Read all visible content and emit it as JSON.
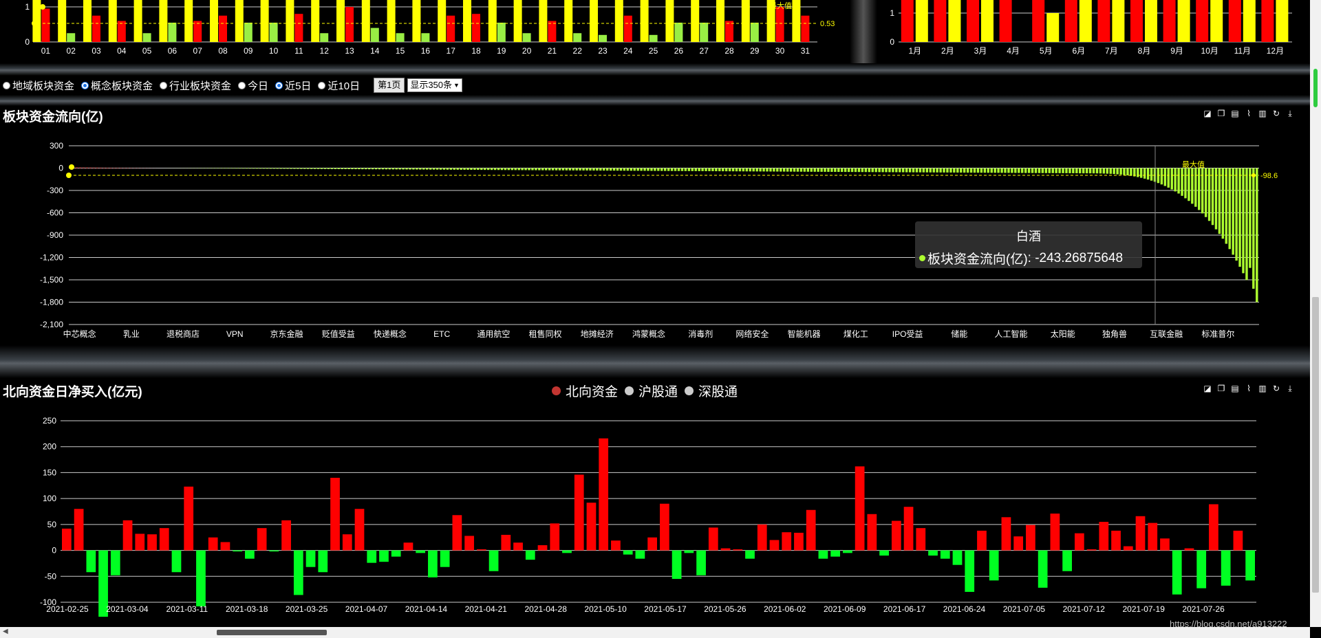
{
  "top_left_chart": {
    "categories": [
      "01",
      "02",
      "03",
      "04",
      "05",
      "06",
      "07",
      "08",
      "09",
      "10",
      "11",
      "12",
      "13",
      "14",
      "15",
      "16",
      "17",
      "18",
      "19",
      "20",
      "21",
      "22",
      "23",
      "24",
      "25",
      "26",
      "27",
      "28",
      "29",
      "30",
      "31"
    ],
    "values": [
      0.95,
      0.25,
      0.75,
      0.6,
      0.25,
      0.55,
      0.6,
      0.75,
      0.55,
      0.55,
      0.8,
      0.25,
      1.0,
      0.4,
      0.25,
      0.25,
      0.75,
      0.8,
      0.55,
      0.25,
      0.6,
      0.25,
      0.2,
      0.75,
      0.2,
      0.55,
      0.55,
      0.6,
      0.55,
      1.0,
      0.75
    ],
    "colors": [
      "#ff0000",
      "#99ee44",
      "#ff0000",
      "#ff0000",
      "#99ee44",
      "#99ee44",
      "#ff0000",
      "#ff0000",
      "#99ee44",
      "#99ee44",
      "#ff0000",
      "#99ee44",
      "#ff0000",
      "#99ee44",
      "#99ee44",
      "#99ee44",
      "#ff0000",
      "#ff0000",
      "#99ee44",
      "#99ee44",
      "#ff0000",
      "#99ee44",
      "#99ee44",
      "#ff0000",
      "#99ee44",
      "#99ee44",
      "#99ee44",
      "#ff0000",
      "#99ee44",
      "#ff0000",
      "#ff0000"
    ],
    "y_ticks": [
      "0",
      "1"
    ],
    "avg_label": "0.53",
    "max_label": "最大值"
  },
  "top_right_chart": {
    "categories": [
      "1月",
      "2月",
      "3月",
      "4月",
      "5月",
      "6月",
      "7月",
      "8月",
      "9月",
      "10月",
      "11月",
      "12月"
    ],
    "y_ticks": [
      "0",
      "1"
    ]
  },
  "controls": {
    "options": [
      {
        "label": "地域板块资金",
        "checked": false
      },
      {
        "label": "概念板块资金",
        "checked": true
      },
      {
        "label": "行业板块资金",
        "checked": false
      },
      {
        "label": "今日",
        "checked": false
      },
      {
        "label": "近5日",
        "checked": true
      },
      {
        "label": "近10日",
        "checked": false
      }
    ],
    "page_button": "第1页",
    "display_select": "显示350条"
  },
  "chart_data": [
    {
      "type": "bar",
      "title": "板块资金流向(亿)",
      "ylim": [
        -2100,
        300
      ],
      "y_ticks": [
        "300",
        "0",
        "-300",
        "-600",
        "-900",
        "-1,200",
        "-1,500",
        "-1,800",
        "-2,100"
      ],
      "x_labels": [
        "中芯概念",
        "乳业",
        "退税商店",
        "VPN",
        "京东金融",
        "贬值受益",
        "快递概念",
        "ETC",
        "通用航空",
        "租售同权",
        "地摊经济",
        "鸿蒙概念",
        "消毒剂",
        "网络安全",
        "智能机器",
        "煤化工",
        "IPO受益",
        "储能",
        "人工智能",
        "太阳能",
        "独角兽",
        "互联金融",
        "标准普尔"
      ],
      "avg_value": -98.6,
      "avg_label": "-98.6",
      "max_label": "最大值",
      "tooltip": {
        "title": "白酒",
        "series": "板块资金流向(亿)",
        "value": "-243.26875648"
      },
      "series": [
        {
          "name": "板块资金流向(亿)",
          "color": "#adff2f"
        }
      ]
    },
    {
      "type": "bar",
      "title": "北向资金日净买入(亿元)",
      "ylim": [
        -100,
        250
      ],
      "y_ticks": [
        "250",
        "200",
        "150",
        "100",
        "50",
        "0",
        "-50",
        "-100"
      ],
      "legend": [
        "北向资金",
        "沪股通",
        "深股通"
      ],
      "legend_colors": [
        "#c23531",
        "#cccccc",
        "#cccccc"
      ],
      "x_labels": [
        "2021-02-25",
        "2021-03-04",
        "2021-03-11",
        "2021-03-18",
        "2021-03-25",
        "2021-04-07",
        "2021-04-14",
        "2021-04-21",
        "2021-04-28",
        "2021-05-10",
        "2021-05-17",
        "2021-05-26",
        "2021-06-02",
        "2021-06-09",
        "2021-06-17",
        "2021-06-24",
        "2021-07-05",
        "2021-07-12",
        "2021-07-19",
        "2021-07-26"
      ],
      "values": [
        42,
        80,
        -42,
        -128,
        -48,
        58,
        32,
        31,
        43,
        -42,
        123,
        -108,
        25,
        16,
        -2,
        -16,
        43,
        -2,
        58,
        -86,
        -32,
        -42,
        140,
        31,
        80,
        -24,
        -22,
        -12,
        15,
        -5,
        -52,
        -32,
        68,
        28,
        2,
        -40,
        30,
        15,
        -18,
        10,
        52,
        -5,
        146,
        92,
        216,
        19,
        -8,
        -16,
        25,
        90,
        -55,
        -5,
        -48,
        44,
        4,
        2,
        -16,
        50,
        20,
        35,
        34,
        78,
        -16,
        -12,
        -5,
        162,
        70,
        -10,
        57,
        84,
        43,
        -10,
        -16,
        -28,
        -80,
        38,
        -58,
        64,
        27,
        49,
        -72,
        71,
        -40,
        33,
        2,
        55,
        38,
        8,
        66,
        53,
        23,
        -85,
        4,
        -73,
        89,
        -68,
        38,
        -58
      ],
      "series": [
        {
          "name": "北向资金",
          "positive_color": "#ff0000",
          "negative_color": "#00ff22"
        }
      ]
    }
  ],
  "watermark": "https://blog.csdn.net/a913222"
}
